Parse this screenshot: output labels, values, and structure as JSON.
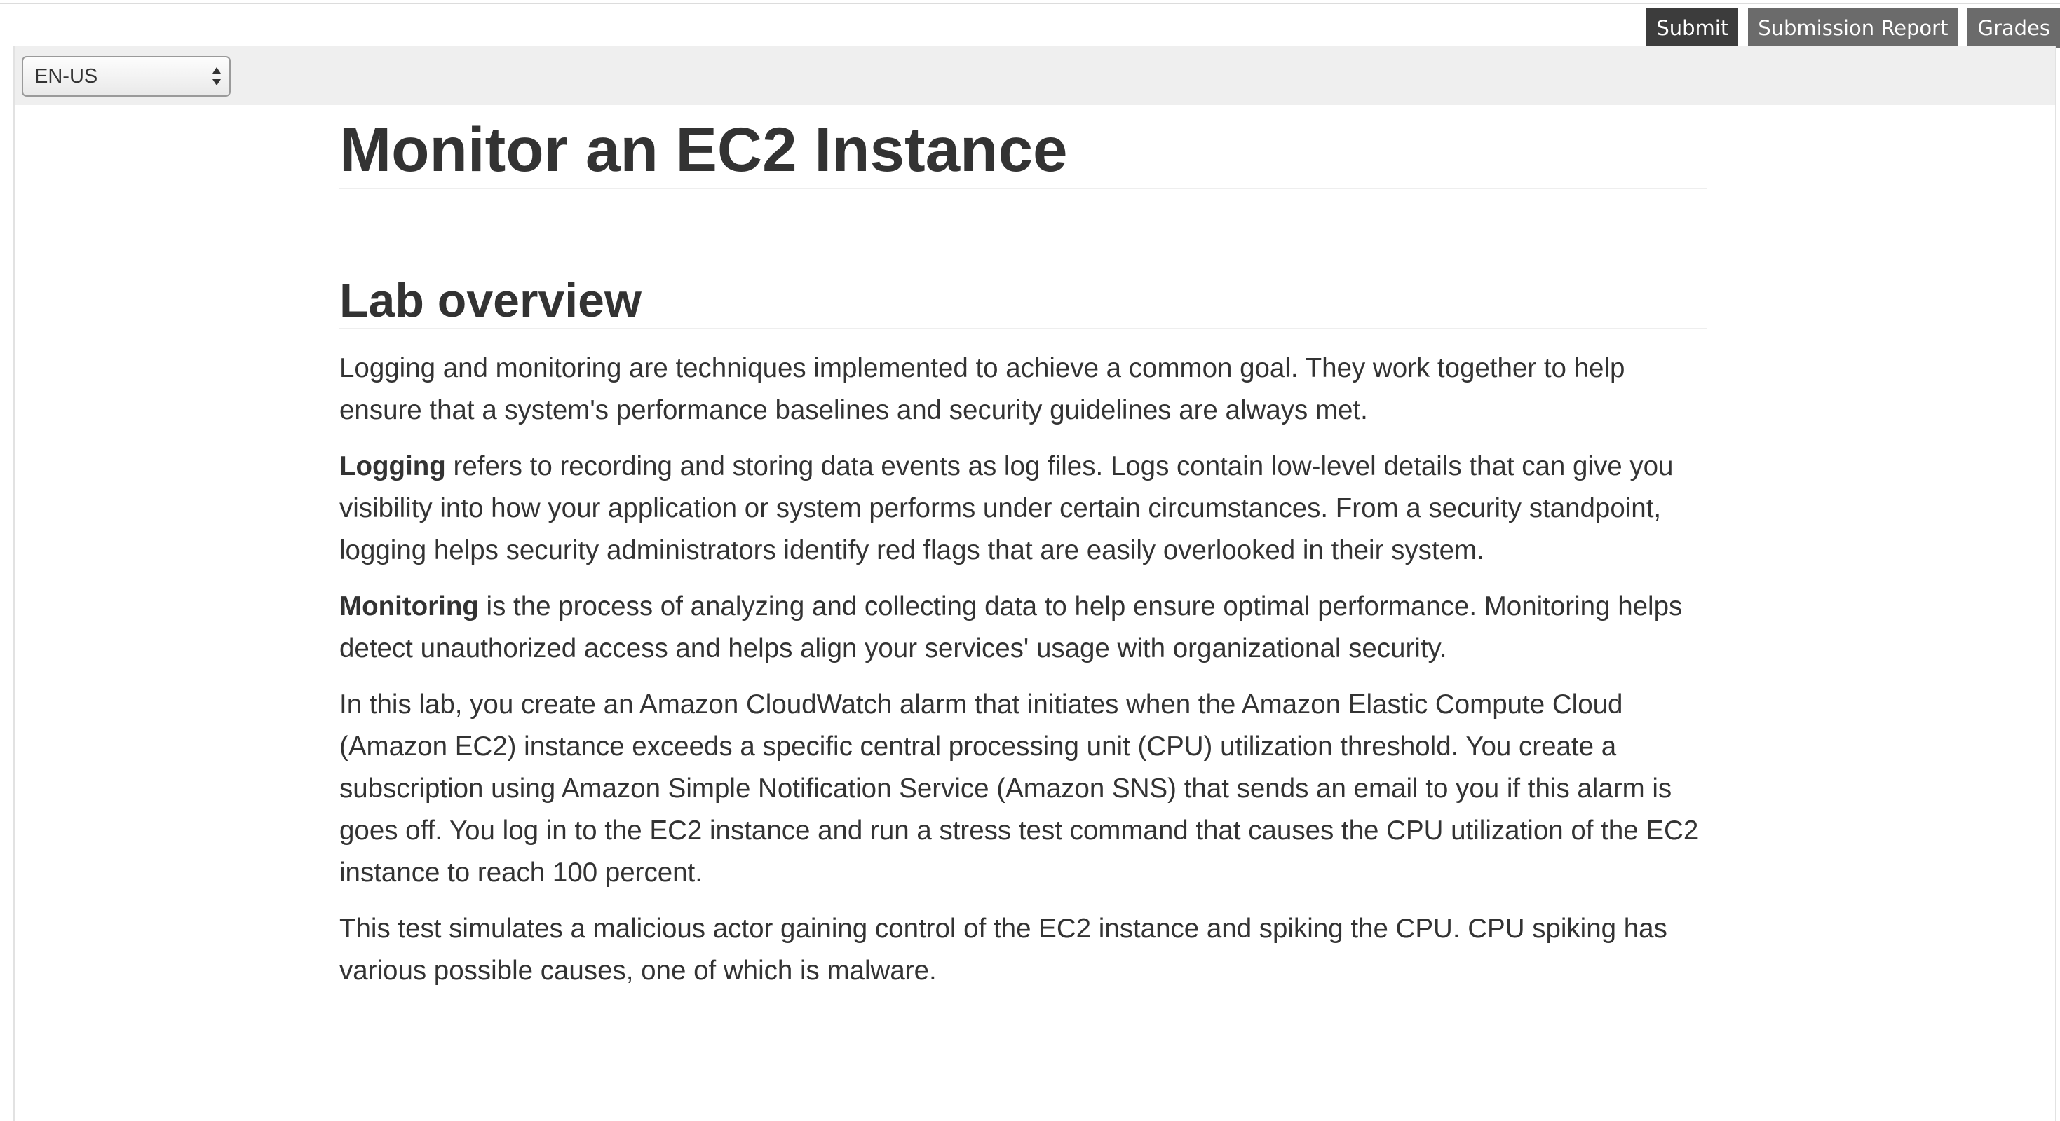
{
  "header": {
    "submit_label": "Submit",
    "submission_report_label": "Submission Report",
    "grades_label": "Grades"
  },
  "toolbar": {
    "language_selected": "EN-US"
  },
  "lab": {
    "title": "Monitor an EC2 Instance",
    "section_heading": "Lab overview",
    "paragraphs": {
      "p1": "Logging and monitoring are techniques implemented to achieve a common goal. They work together to help ensure that a system's performance baselines and security guidelines are always met.",
      "p2_bold": "Logging",
      "p2_rest": " refers to recording and storing data events as log files. Logs contain low-level details that can give you visibility into how your application or system performs under certain circumstances. From a security standpoint, logging helps security administrators identify red flags that are easily overlooked in their system.",
      "p3_bold": "Monitoring",
      "p3_rest": " is the process of analyzing and collecting data to help ensure optimal performance. Monitoring helps detect unauthorized access and helps align your services' usage with organizational security.",
      "p4": "In this lab, you create an Amazon CloudWatch alarm that initiates when the Amazon Elastic Compute Cloud (Amazon EC2) instance exceeds a specific central processing unit (CPU) utilization threshold. You create a subscription using Amazon Simple Notification Service (Amazon SNS) that sends an email to you if this alarm is goes off. You log in to the EC2 instance and run a stress test command that causes the CPU utilization of the EC2 instance to reach 100 percent.",
      "p5": "This test simulates a malicious actor gaining control of the EC2 instance and spiking the CPU. CPU spiking has various possible causes, one of which is malware."
    }
  }
}
